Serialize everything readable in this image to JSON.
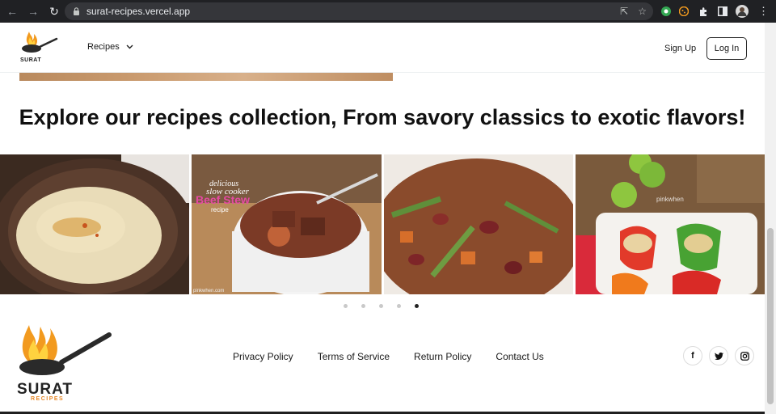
{
  "browser": {
    "url": "surat-recipes.vercel.app"
  },
  "header": {
    "brand": "SURAT",
    "recipes_menu": "Recipes",
    "signup": "Sign Up",
    "login": "Log In"
  },
  "main": {
    "headline": "Explore our recipes collection, From savory classics to exotic flavors!",
    "carousel": {
      "slides": [
        {
          "name": "hummus"
        },
        {
          "name": "beef-stew",
          "caption_line1": "delicious",
          "caption_line2": "slow cooker",
          "caption_line3": "Beef Stew",
          "caption_line4": "recipe",
          "watermark": "pinkwhen.com"
        },
        {
          "name": "rice-beans-stew"
        },
        {
          "name": "stuffed-peppers",
          "watermark": "pinkwhen"
        }
      ],
      "active_dot_index": 4,
      "dot_count": 5
    }
  },
  "footer": {
    "brand": "SURAT",
    "brand_sub": "RECIPES",
    "links": [
      "Privacy Policy",
      "Terms of Service",
      "Return Policy",
      "Contact Us"
    ],
    "socials": [
      "facebook-icon",
      "twitter-icon",
      "instagram-icon"
    ]
  },
  "colors": {
    "flame_orange": "#f29a1f",
    "flame_yellow": "#ffd23f",
    "pan_dark": "#2a2a2a",
    "brand_sub": "#e8892a"
  }
}
